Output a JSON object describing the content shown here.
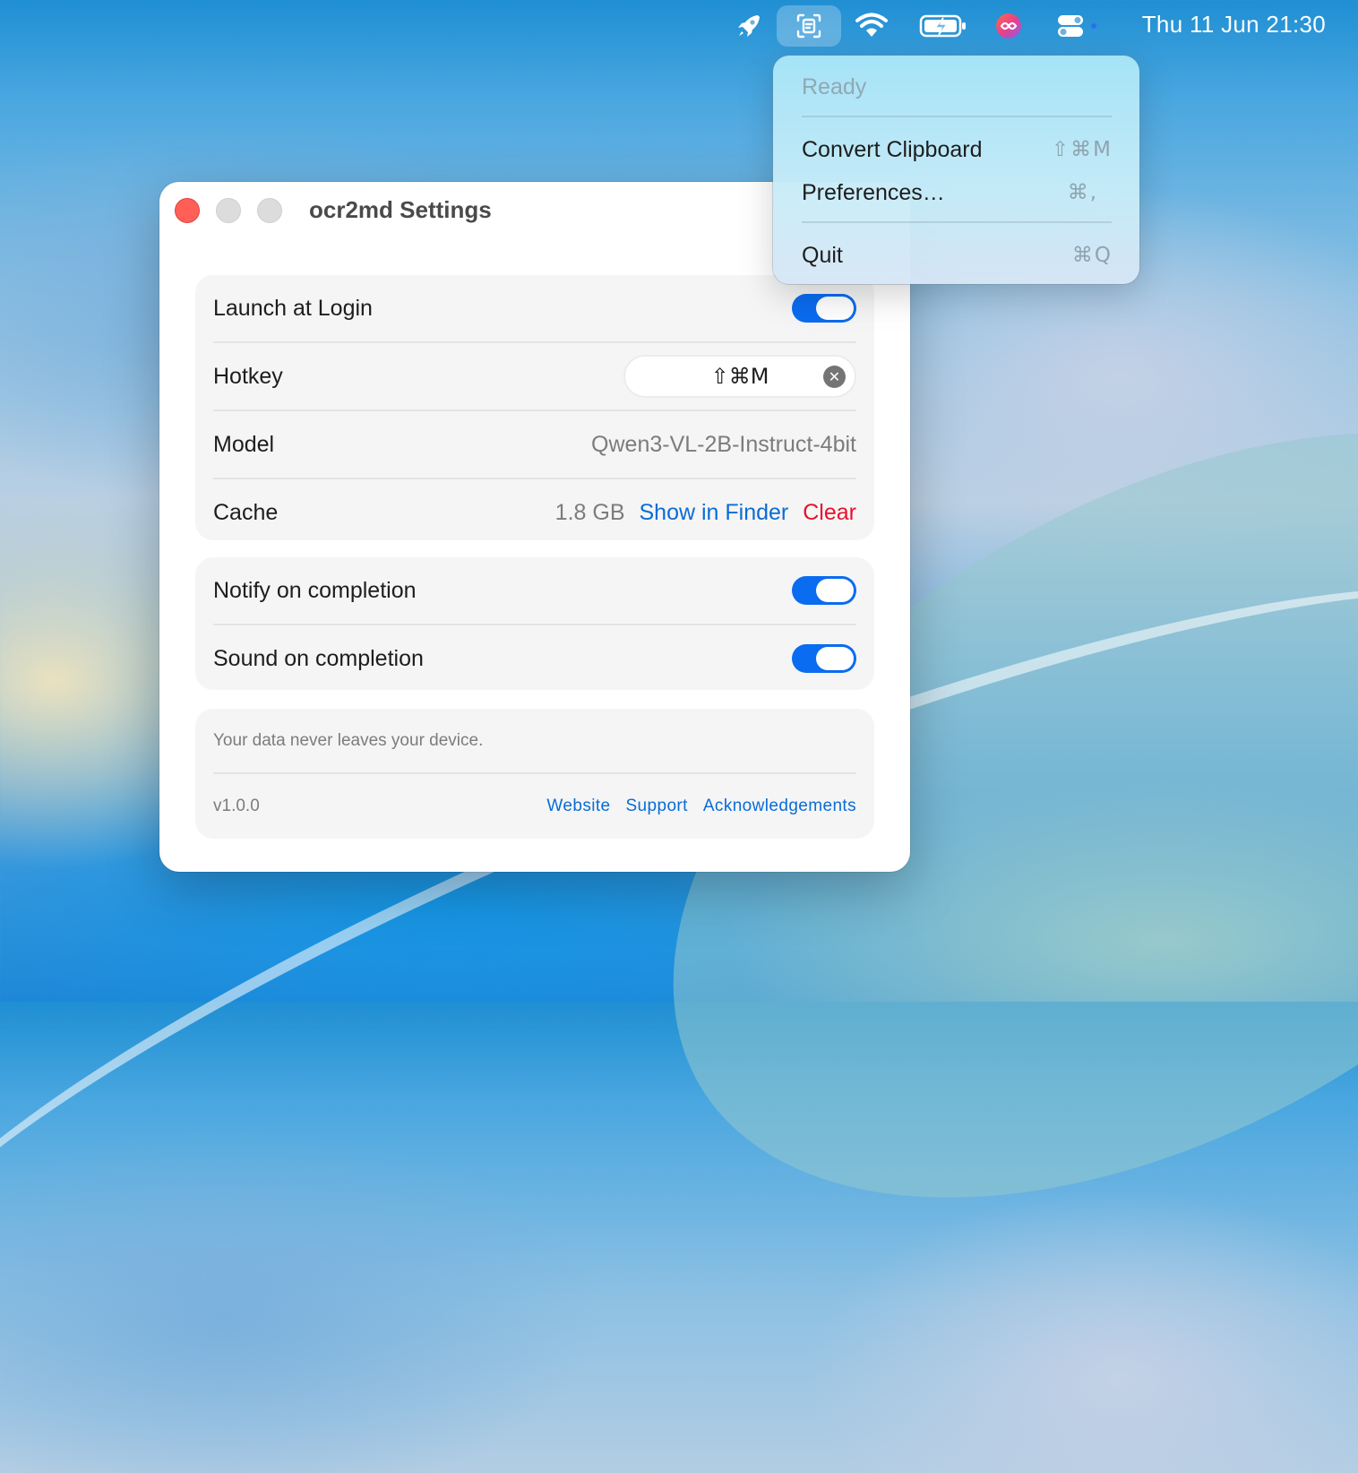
{
  "menubar": {
    "icons": [
      "rocket-icon",
      "text-recognition-icon",
      "wifi-icon",
      "battery-charging-icon",
      "app-logo-icon",
      "control-center-icon"
    ],
    "clock": "Thu 11 Jun  21:30"
  },
  "menu": {
    "status": "Ready",
    "items": [
      {
        "label": "Convert Clipboard",
        "shortcut": "⇧⌘M"
      },
      {
        "label": "Preferences…",
        "shortcut": "⌘,"
      },
      {
        "label": "Quit",
        "shortcut": "⌘Q"
      }
    ]
  },
  "window": {
    "title": "ocr2md Settings",
    "general": {
      "launch_at_login": {
        "label": "Launch at Login",
        "enabled": true
      },
      "hotkey": {
        "label": "Hotkey",
        "value": "⇧⌘M"
      },
      "model": {
        "label": "Model",
        "value": "Qwen3-VL-2B-Instruct-4bit"
      },
      "cache": {
        "label": "Cache",
        "size": "1.8 GB",
        "show_label": "Show in Finder",
        "clear_label": "Clear"
      }
    },
    "notifications": {
      "notify": {
        "label": "Notify on completion",
        "enabled": true
      },
      "sound": {
        "label": "Sound on completion",
        "enabled": true
      }
    },
    "footer": {
      "privacy": "Your data never leaves your device.",
      "version": "v1.0.0",
      "links": [
        "Website",
        "Support",
        "Acknowledgements"
      ]
    }
  },
  "colors": {
    "accent": "#0a6cf0",
    "link": "#0a6cd6",
    "danger": "#e8112d",
    "close": "#ff5f57"
  }
}
